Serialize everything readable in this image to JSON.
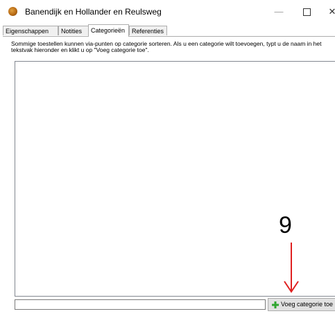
{
  "window": {
    "title": "Banendijk en Hollander en Reulsweg",
    "minimize_glyph": "—",
    "close_glyph": "✕"
  },
  "tabs": [
    {
      "label": "Eigenschappen",
      "active": false
    },
    {
      "label": "Notities",
      "active": false
    },
    {
      "label": "Categorieën",
      "active": true
    },
    {
      "label": "Referenties",
      "active": false
    }
  ],
  "category_tab": {
    "description": "Sommige toestellen kunnen via-punten op categorie sorteren.  Als u een categorie wilt toevoegen, typt u de naam in het tekstvak hieronder en klikt u op \"Voeg categorie toe\".",
    "category_input_value": "",
    "add_button_label": "Voeg categorie toe"
  },
  "annotation": {
    "number": "9",
    "color": "#e02020"
  },
  "icons": {
    "app": "app-globe-icon",
    "add": "green-plus-icon"
  }
}
